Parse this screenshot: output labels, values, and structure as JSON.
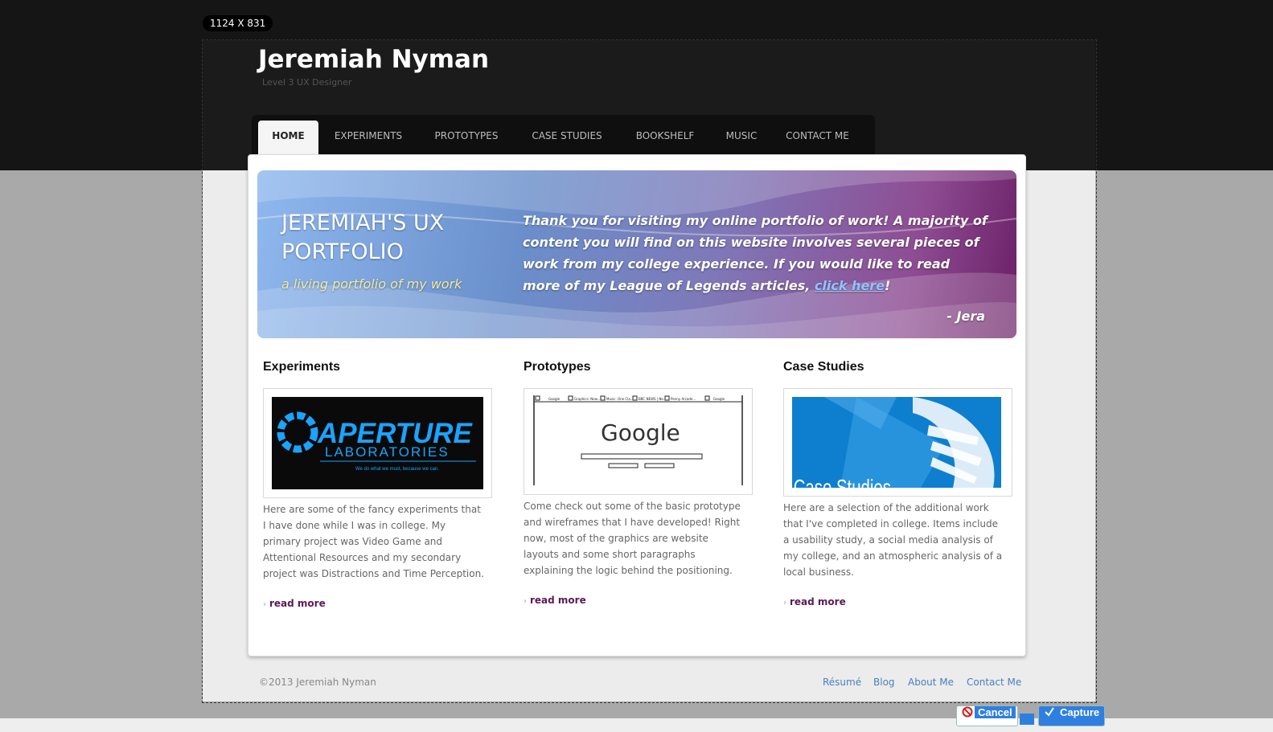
{
  "viewport_badge": "1124 X 831",
  "site": {
    "title": "Jeremiah Nyman",
    "subtitle": "Level 3 UX Designer"
  },
  "nav": {
    "items": [
      {
        "label": "HOME",
        "active": true
      },
      {
        "label": "EXPERIMENTS"
      },
      {
        "label": "PROTOTYPES"
      },
      {
        "label": "CASE STUDIES"
      },
      {
        "label": "BOOKSHELF"
      },
      {
        "label": "MUSIC"
      },
      {
        "label": "CONTACT ME"
      }
    ]
  },
  "hero": {
    "title": "JEREMIAH'S UX PORTFOLIO",
    "tagline": "a living portfolio of my work",
    "text_before": "Thank you for visiting my online portfolio of work! A majority of content you will find on this website involves several pieces of work from my college experience. If you would like to read more of my League of Legends articles, ",
    "link_text": "click here",
    "text_after": "!",
    "signature": "- Jera"
  },
  "columns": [
    {
      "title": "Experiments",
      "thumb": {
        "brand": "APERTURE",
        "sub": "LABORATORIES",
        "motto": "We do what we must, because we can."
      },
      "text": "Here are some of the fancy experiments that I have done while I was in college. My primary project was Video Game and Attentional Resources and my secondary project was Distractions and Time Perception.",
      "read_more": "read more"
    },
    {
      "title": "Prototypes",
      "thumb": {
        "logo": "Google",
        "tabs": [
          "Google",
          "Graphics: New...",
          "Music: One Cla...",
          "BBC NEWS | Ne...",
          "Penny Arcade...",
          "Google"
        ]
      },
      "text": "Come check out some of the basic prototype and wireframes that I have developed! Right now, most of the graphics are website layouts and some short paragraphs explaining the logic behind the positioning.",
      "read_more": "read more"
    },
    {
      "title": "Case Studies",
      "thumb": {
        "label": "Case Studies"
      },
      "text": "Here are a selection of the additional work that I've completed in college. Items include a usability study, a social media analysis of my college, and an atmospheric analysis of a local business.",
      "read_more": "read more"
    }
  ],
  "footer": {
    "copyright": "©2013 Jeremiah Nyman",
    "links": [
      "Résumé",
      "Blog",
      "About Me",
      "Contact Me"
    ]
  },
  "capture_toolbar": {
    "cancel_label": "Cancel",
    "capture_label": "Capture"
  },
  "colors": {
    "accent_purple": "#5a1b58",
    "link_blue": "#4a7fc1",
    "capture_blue": "#2f7fe0"
  }
}
